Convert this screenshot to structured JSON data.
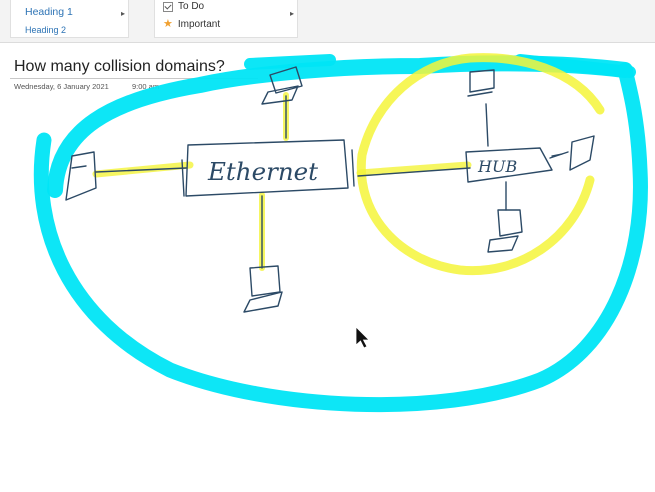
{
  "ribbon": {
    "styles": [
      "Heading 1",
      "Heading 2"
    ],
    "tags": {
      "todo_label": "To Do",
      "important_label": "Important"
    },
    "gallery_arrow": "▸"
  },
  "page": {
    "title": "How many collision domains?",
    "date": "Wednesday, 6 January 2021",
    "time": "9:00 am"
  },
  "ink": {
    "ethernet_label": "Ethernet",
    "hub_label": "HUB"
  },
  "colors": {
    "cyan_highlighter": "#00e5f5",
    "yellow_highlighter": "#f4f43a",
    "pen": "#2c4a66",
    "heading_blue": "#2e74b5"
  },
  "icons": {
    "todo": "checkbox-icon",
    "important": "star-icon",
    "cursor": "mouse-pointer-icon"
  }
}
